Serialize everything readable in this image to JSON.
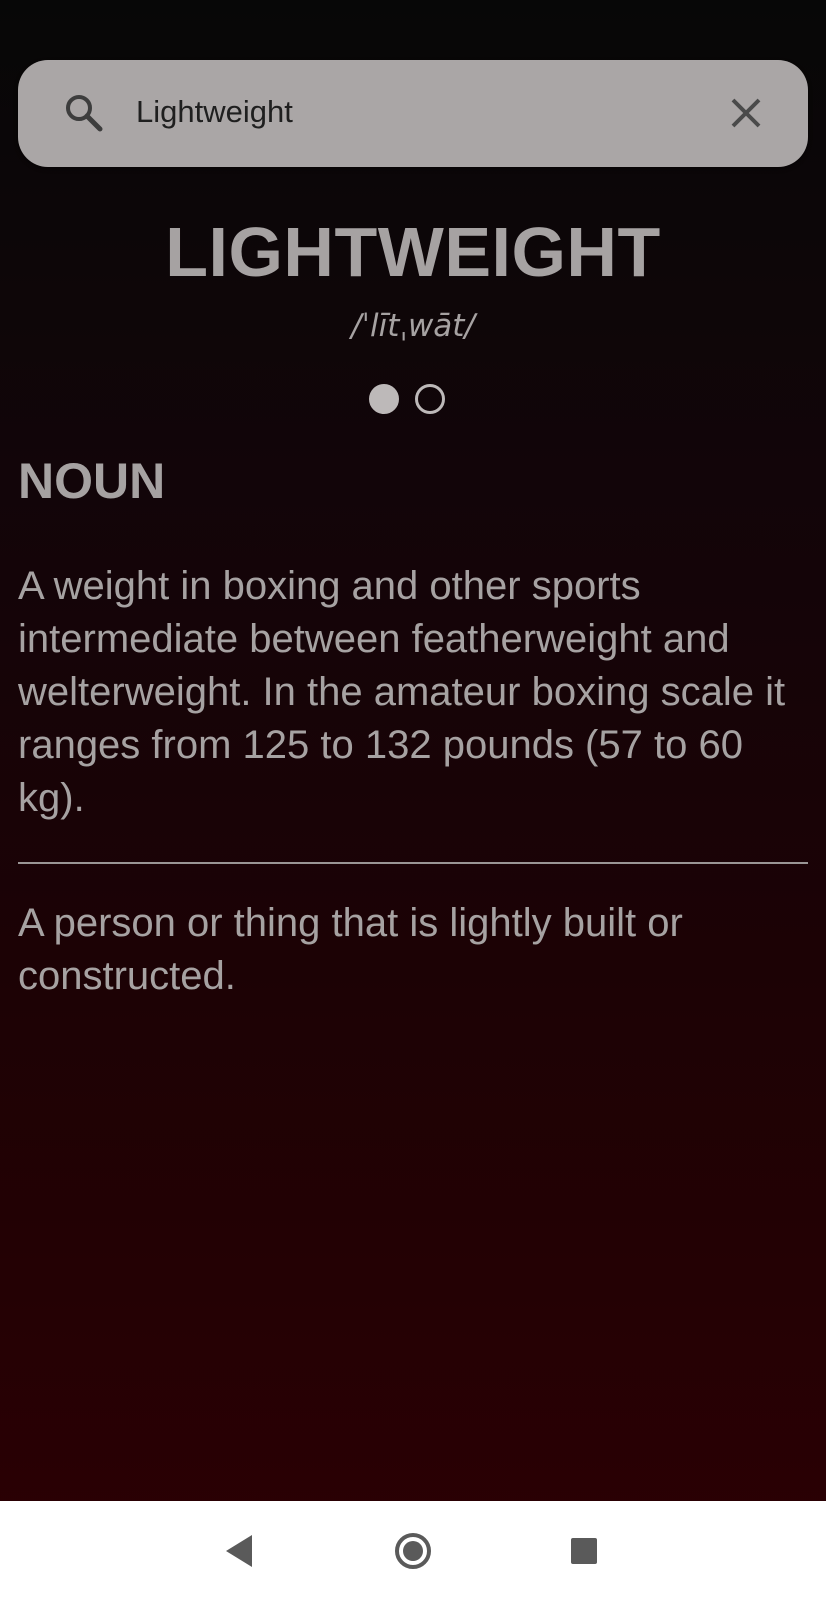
{
  "search": {
    "value": "Lightweight",
    "icon": "search-icon",
    "clear_icon": "close-icon"
  },
  "entry": {
    "headword": "LIGHTWEIGHT",
    "pronunciation": "/ˈlītˌwāt/",
    "pager": {
      "pages": 2,
      "active_page": 1
    },
    "part_of_speech": "NOUN",
    "definitions": [
      "A weight in boxing and other sports intermediate between featherweight and welterweight. In the amateur boxing scale it ranges from 125 to 132 pounds (57 to 60 kg).",
      "A person or thing that is lightly built or constructed."
    ]
  },
  "navigation": {
    "back_icon": "back-triangle-icon",
    "home_icon": "home-circle-icon",
    "recents_icon": "recents-square-icon"
  },
  "colors": {
    "text": "#a6a2a2",
    "search_bar": "#aaa6a6",
    "background_top": "#070707",
    "background_bottom": "#2c0003"
  }
}
